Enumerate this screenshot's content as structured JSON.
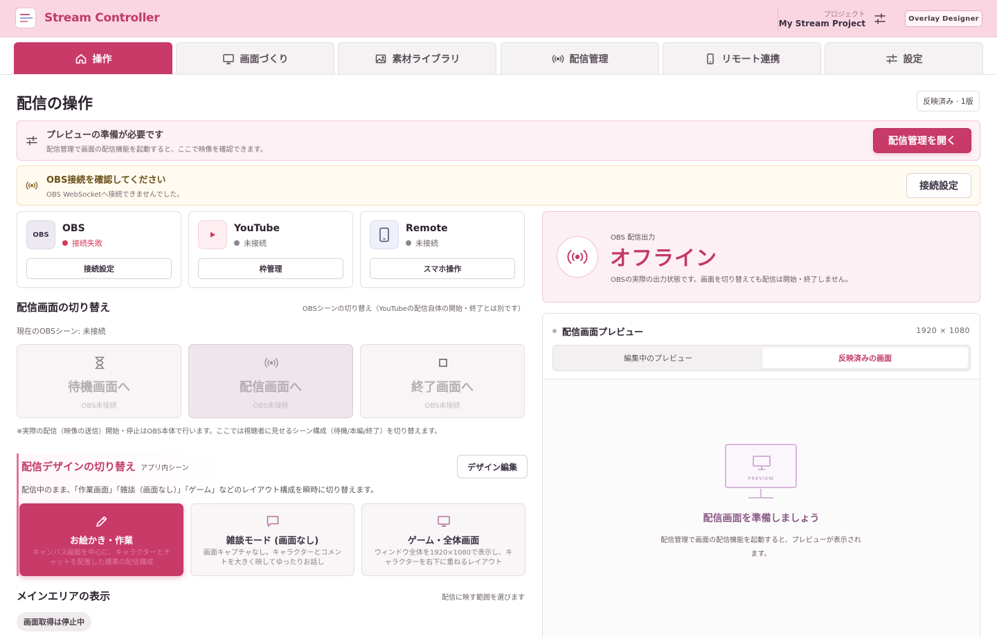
{
  "app": {
    "title": "Stream Controller",
    "project_label": "プロジェクト",
    "project_name": "My Stream Project",
    "overlay_button": "Overlay Designer"
  },
  "tabs": [
    {
      "label": "操作",
      "icon": "home-icon",
      "active": true
    },
    {
      "label": "画面づくり",
      "icon": "monitor-icon"
    },
    {
      "label": "素材ライブラリ",
      "icon": "image-icon"
    },
    {
      "label": "配信管理",
      "icon": "broadcast-icon"
    },
    {
      "label": "リモート連携",
      "icon": "smartphone-icon"
    },
    {
      "label": "設定",
      "icon": "sliders-icon"
    }
  ],
  "page": {
    "title": "配信の操作",
    "version_badge": "反映済み · 1版"
  },
  "banners": {
    "preview": {
      "title": "プレビューの準備が必要です",
      "desc": "配信管理で画面の配信機能を起動すると、ここで映像を確認できます。",
      "button": "配信管理を開く"
    },
    "obs": {
      "title": "OBS接続を確認してください",
      "desc": "OBS WebSocketへ接続できませんでした。",
      "button": "接続設定"
    }
  },
  "services": [
    {
      "name": "OBS",
      "logo_text": "OBS",
      "status": "接続失敗",
      "status_color": "#d23a5a",
      "button": "接続設定"
    },
    {
      "name": "YouTube",
      "status": "未接続",
      "status_color": "#8a8590",
      "button": "枠管理"
    },
    {
      "name": "Remote",
      "status": "未接続",
      "status_color": "#8a8590",
      "button": "スマホ操作"
    }
  ],
  "scene_switch": {
    "title": "配信画面の切り替え",
    "note": "OBSシーンの切り替え（YouTubeの配信自体の開始・終了とは別です）",
    "current": "現在のOBSシーン: 未接続",
    "buttons": [
      {
        "label": "待機画面へ",
        "sub": "OBS未接続",
        "icon": "hourglass-icon"
      },
      {
        "label": "配信画面へ",
        "sub": "OBS未接続",
        "icon": "broadcast-icon"
      },
      {
        "label": "終了画面へ",
        "sub": "OBS未接続",
        "icon": "stop-icon"
      }
    ],
    "footnote": "※実際の配信（映像の送信）開始・停止はOBS本体で行います。ここでは視聴者に見せるシーン構成（待機/本編/終了）を切り替えます。"
  },
  "design_switch": {
    "title": "配信デザインの切り替え",
    "tag": "アプリ内シーン",
    "edit_button": "デザイン編集",
    "desc": "配信中のまま、「作業画面」「雑談（画面なし）」「ゲーム」などのレイアウト構成を瞬時に切り替えます。",
    "cards": [
      {
        "title": "お絵かき・作業",
        "desc": "キャンバス画面を中心に、キャラクターとチャットを配置した標準の配信構成",
        "icon": "pencil-icon",
        "active": true
      },
      {
        "title": "雑談モード (画面なし)",
        "desc": "画面キャプチャなし。キャラクターとコメントを大きく映してゆったりお話し",
        "icon": "chat-bubble-icon"
      },
      {
        "title": "ゲーム・全体画面",
        "desc": "ウィンドウ全体を1920×1080で表示し、キャラクターを右下に重ねるレイアウト",
        "icon": "monitor-icon"
      }
    ]
  },
  "main_area": {
    "title": "メインエリアの表示",
    "note": "配信に映す範囲を選びます",
    "capture_pill": "画面取得は停止中"
  },
  "obs_output": {
    "label": "OBS 配信出力",
    "value": "オフライン",
    "desc": "OBSの実際の出力状態です。画面を切り替えても配信は開始・終了しません。"
  },
  "preview": {
    "title": "配信画面プレビュー",
    "resolution": "1920 × 1080",
    "tabs": [
      {
        "label": "編集中のプレビュー"
      },
      {
        "label": "反映済みの画面",
        "active": true
      }
    ],
    "monitor_text": "PREVIEW",
    "prepare_title": "配信画面を準備しましょう",
    "prepare_desc": "配信管理で画面の配信機能を起動すると、プレビューが表示されます。"
  },
  "colors": {
    "accent": "#c83a68",
    "header_bg": "#fad6e2",
    "error": "#d23a5a"
  }
}
